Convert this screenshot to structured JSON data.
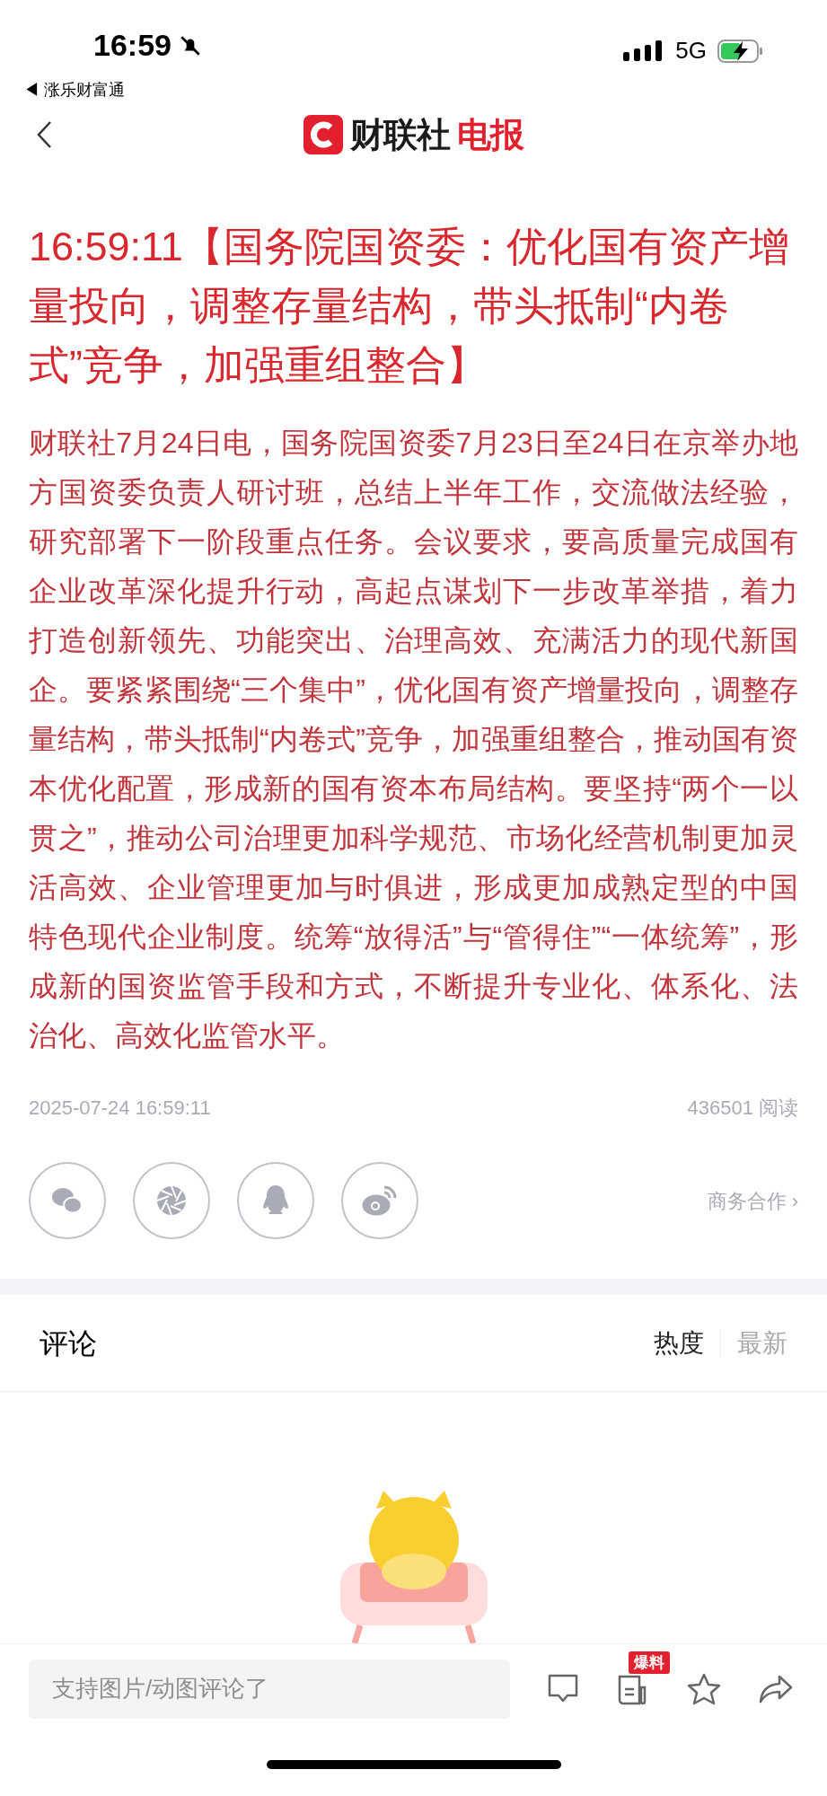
{
  "status_bar": {
    "time": "16:59",
    "back_app": "◀ 涨乐财富通",
    "network": "5G"
  },
  "header": {
    "logo_parts": [
      {
        "text": "财联社",
        "kind": "plain"
      },
      {
        "text": "电报",
        "kind": "accent"
      }
    ]
  },
  "article": {
    "time": "16:59:11",
    "title": "【国务院国资委：优化国有资产增量投向，调整存量结构，带头抵制“内卷式”竞争，加强重组整合】",
    "body": "财联社7月24日电，国务院国资委7月23日至24日在京举办地方国资委负责人研讨班，总结上半年工作，交流做法经验，研究部署下一阶段重点任务。会议要求，要高质量完成国有企业改革深化提升行动，高起点谋划下一步改革举措，着力打造创新领先、功能突出、治理高效、充满活力的现代新国企。要紧紧围绕“三个集中”，优化国有资产增量投向，调整存量结构，带头抵制“内卷式”竞争，加强重组整合，推动国有资本优化配置，形成新的国有资本布局结构。要坚持“两个一以贯之”，推动公司治理更加科学规范、市场化经营机制更加灵活高效、企业管理更加与时俱进，形成更加成熟定型的中国特色现代企业制度。统筹“放得活”与“管得住”“一体统筹”，形成新的国资监管手段和方式，不断提升专业化、体系化、法治化、高效化监管水平。",
    "date": "2025-07-24 16:59:11",
    "reads": "436501 阅读"
  },
  "share": {
    "business_link": "商务合作 ›"
  },
  "comments": {
    "title": "评论",
    "sort_tabs": [
      {
        "label": "热度",
        "selected": true
      },
      {
        "label": "最新",
        "selected": false
      }
    ]
  },
  "bottom_bar": {
    "placeholder": "支持图片/动图评论了",
    "badge": "爆料"
  }
}
